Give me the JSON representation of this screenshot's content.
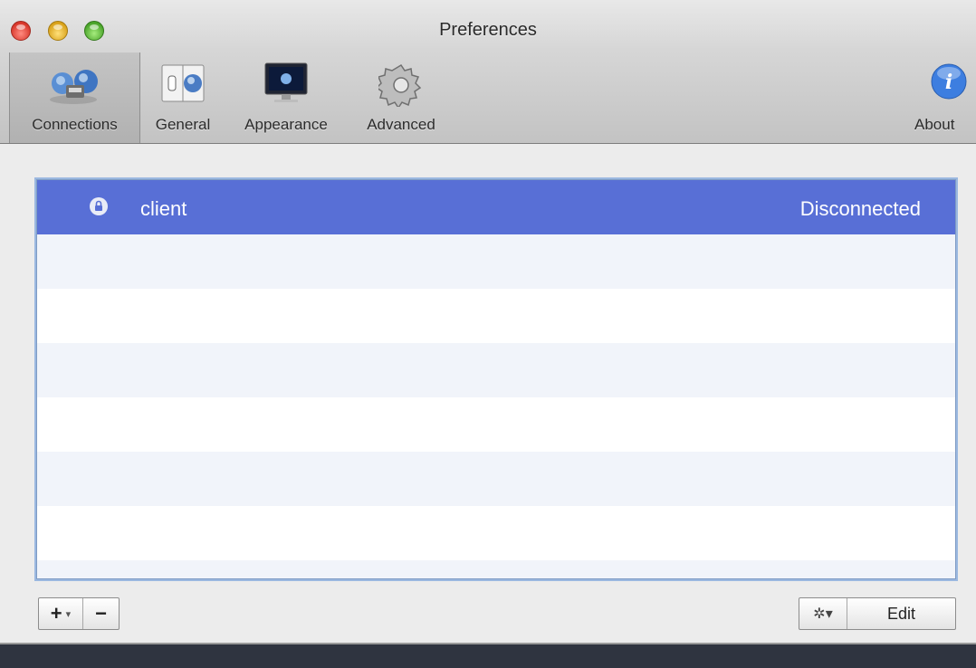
{
  "window": {
    "title": "Preferences"
  },
  "toolbar": {
    "items": [
      {
        "label": "Connections",
        "icon": "network-globe-icon",
        "selected": true
      },
      {
        "label": "General",
        "icon": "switch-panel-icon",
        "selected": false
      },
      {
        "label": "Appearance",
        "icon": "monitor-icon",
        "selected": false
      },
      {
        "label": "Advanced",
        "icon": "gear-icon",
        "selected": false
      }
    ],
    "about_label": "About",
    "about_icon": "info-icon"
  },
  "connections": [
    {
      "name": "client",
      "status": "Disconnected",
      "locked": true,
      "selected": true
    }
  ],
  "footer": {
    "add_label": "+",
    "add_menu_glyph": "▾",
    "remove_label": "−",
    "action_glyph": "✲▾",
    "edit_label": "Edit"
  },
  "colors": {
    "selection": "#586fd6",
    "list_border": "#9bb8e0"
  }
}
